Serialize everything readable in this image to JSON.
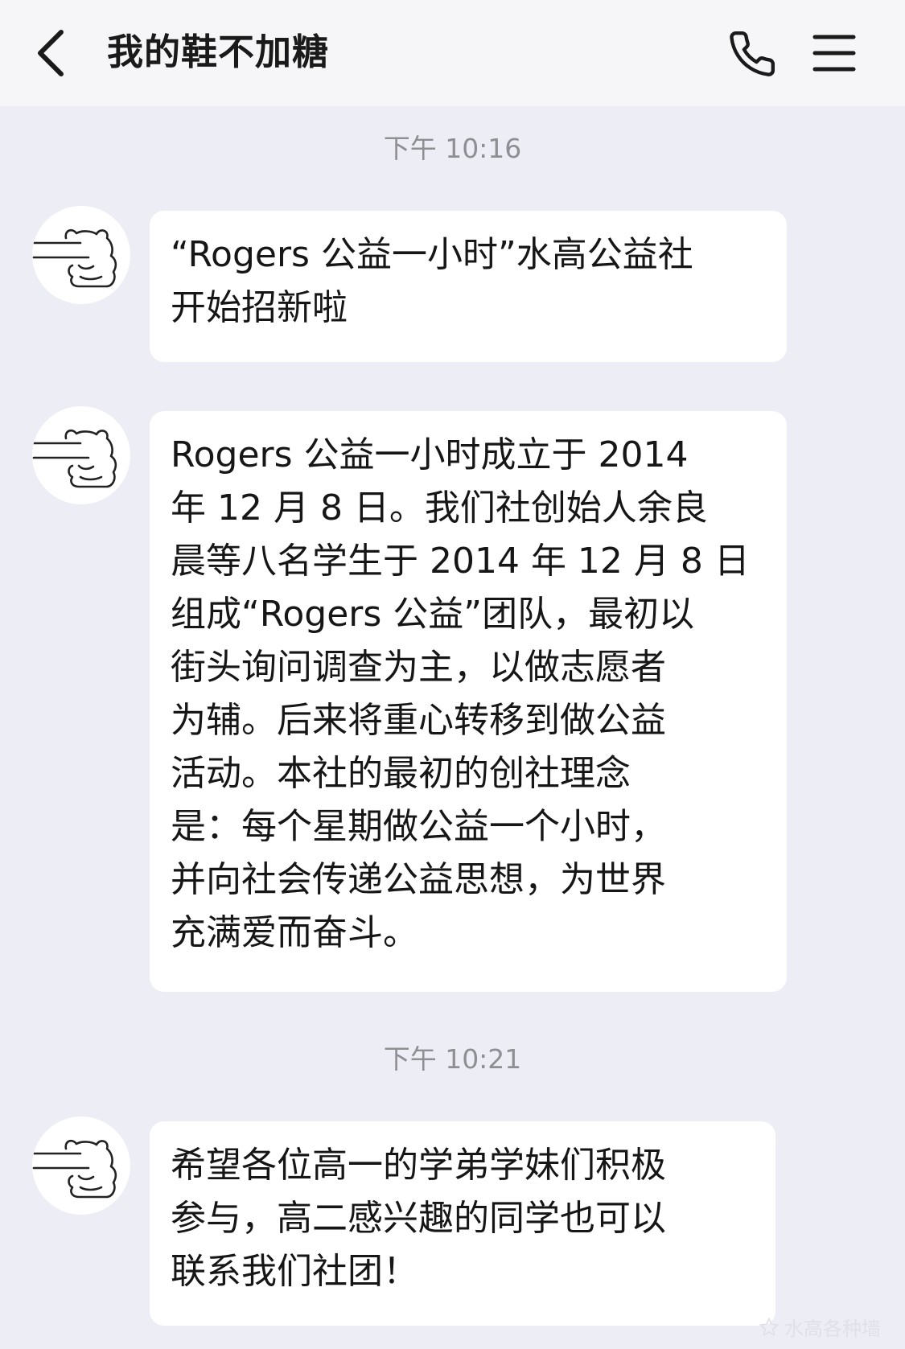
{
  "header": {
    "back_icon": "chevron-left-icon",
    "title": "我的鞋不加糖",
    "phone_icon": "phone-icon",
    "menu_icon": "hamburger-menu-icon"
  },
  "chat": {
    "timestamps": [
      "下午 10:16",
      "下午 10:21"
    ],
    "avatar_icon": "bear-doodle-avatar",
    "messages": [
      {
        "text": "“Rogers 公益一小时”水高公益社\n开始招新啦"
      },
      {
        "text": "Rogers 公益一小时成立于 2014\n年 12 月 8 日。我们社创始人余良\n晨等八名学生于 2014 年 12 月 8 日\n组成“Rogers 公益”团队，最初以\n街头询问调查为主，以做志愿者\n为辅。后来将重心转移到做公益\n活动。本社的最初的创社理念\n是：每个星期做公益一个小时，\n并向社会传递公益思想，为世界\n充满爱而奋斗。"
      },
      {
        "text": "希望各位高一的学弟学妹们积极\n参与，高二感兴趣的同学也可以\n联系我们社团！"
      }
    ]
  },
  "watermark": {
    "text": "水高各种墙",
    "icon": "star-icon"
  }
}
